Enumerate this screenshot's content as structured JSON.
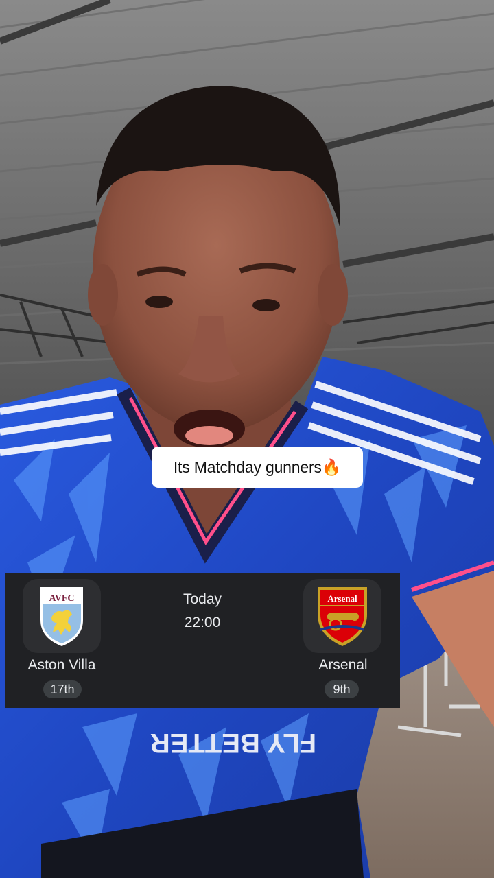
{
  "caption": {
    "text": "Its Matchday gunners🔥"
  },
  "match": {
    "home": {
      "name": "Aston Villa",
      "crest_text": "AVFC",
      "position": "17th"
    },
    "away": {
      "name": "Arsenal",
      "crest_text": "Arsenal",
      "position": "9th"
    },
    "day": "Today",
    "time": "22:00"
  },
  "jersey_text": "FLY BETTER",
  "colors": {
    "card_bg": "#202124",
    "villa_claret": "#7a1f3d",
    "villa_blue": "#95bfe5",
    "villa_yellow": "#f3d13a",
    "arsenal_red": "#db0007",
    "arsenal_gold": "#c9a227",
    "jersey_blue": "#1f4fd6"
  }
}
